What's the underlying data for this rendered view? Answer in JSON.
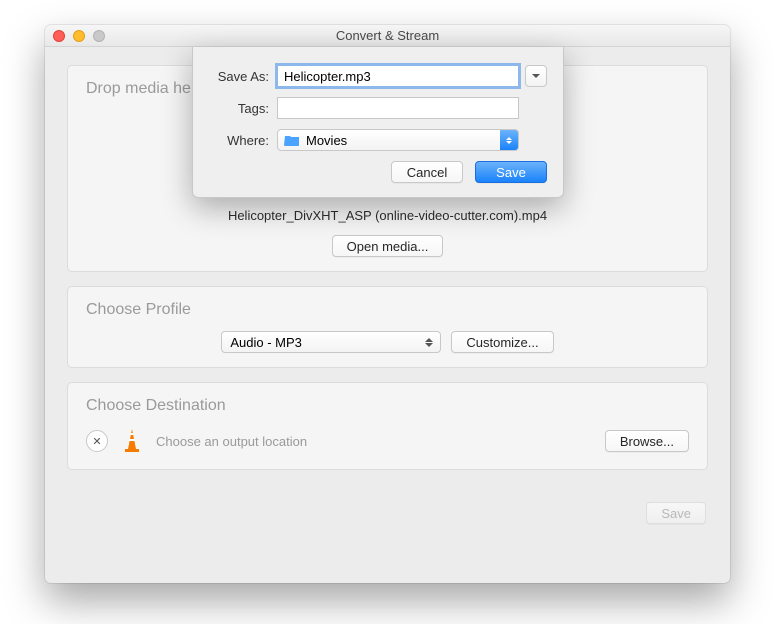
{
  "window": {
    "title": "Convert & Stream"
  },
  "drop": {
    "heading": "Drop media here",
    "filename": "Helicopter_DivXHT_ASP (online-video-cutter.com).mp4",
    "open_label": "Open media..."
  },
  "profile": {
    "heading": "Choose Profile",
    "selected": "Audio - MP3",
    "customize_label": "Customize..."
  },
  "destination": {
    "heading": "Choose Destination",
    "placeholder": "Choose an output location",
    "browse_label": "Browse..."
  },
  "footer": {
    "save_label": "Save"
  },
  "sheet": {
    "save_as_label": "Save As:",
    "save_as_value": "Helicopter.mp3",
    "tags_label": "Tags:",
    "tags_value": "",
    "where_label": "Where:",
    "where_value": "Movies",
    "cancel_label": "Cancel",
    "save_label": "Save"
  }
}
